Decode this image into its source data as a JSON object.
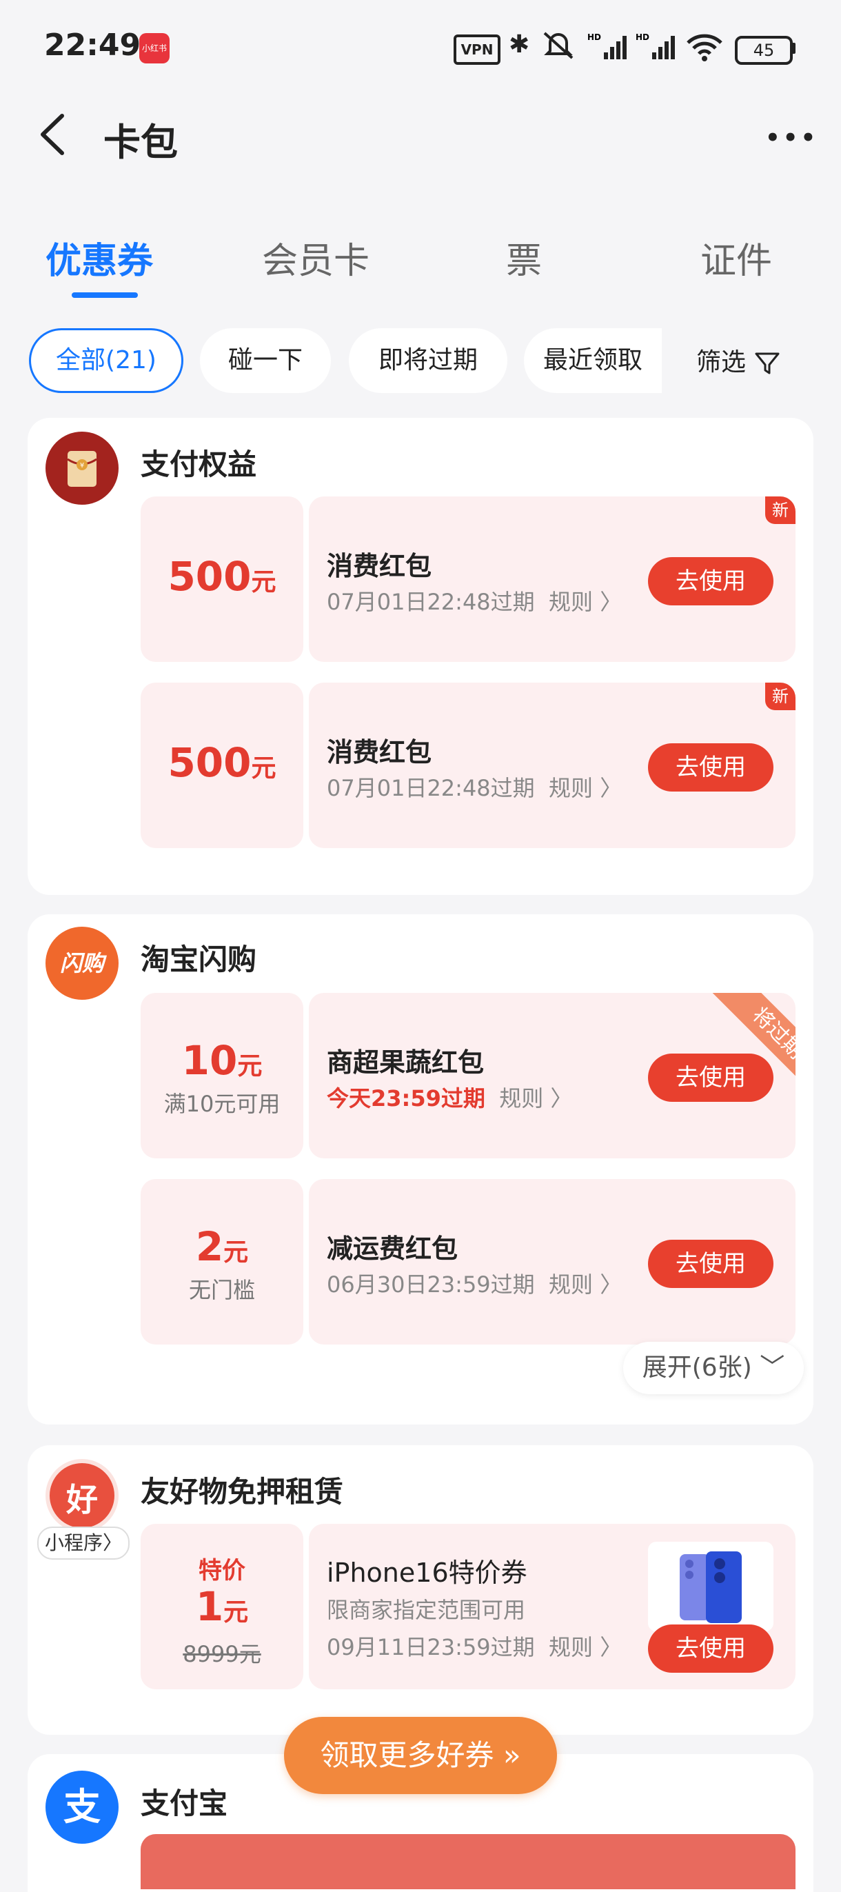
{
  "status_bar": {
    "time": "22:49",
    "app_badge": "小红书",
    "vpn": "VPN",
    "battery": "45",
    "icons": [
      "vpn-icon",
      "bluetooth-icon",
      "mute-icon",
      "signal-hd-icon",
      "signal-hd-icon",
      "wifi-icon",
      "battery-icon"
    ]
  },
  "header": {
    "title": "卡包",
    "more": "•••"
  },
  "tabs": [
    {
      "label": "优惠券",
      "active": true
    },
    {
      "label": "会员卡",
      "active": false
    },
    {
      "label": "票",
      "active": false
    },
    {
      "label": "证件",
      "active": false
    }
  ],
  "filters": [
    {
      "label": "全部(21)",
      "active": true
    },
    {
      "label": "碰一下",
      "active": false
    },
    {
      "label": "即将过期",
      "active": false
    },
    {
      "label": "最近领取",
      "active": false
    }
  ],
  "filter_button": "筛选",
  "sections": [
    {
      "title": "支付权益",
      "coupons": [
        {
          "amount": "500",
          "unit": "元",
          "name": "消费红包",
          "expiry": "07月01日22:48过期",
          "rule": "规则 〉",
          "button": "去使用",
          "tag": "新"
        },
        {
          "amount": "500",
          "unit": "元",
          "name": "消费红包",
          "expiry": "07月01日22:48过期",
          "rule": "规则 〉",
          "button": "去使用",
          "tag": "新"
        }
      ]
    },
    {
      "title": "淘宝闪购",
      "logo_text": "闪购",
      "coupons": [
        {
          "amount": "10",
          "unit": "元",
          "sub": "满10元可用",
          "name": "商超果蔬红包",
          "expiry": "今天23:59过期",
          "rule": "规则 〉",
          "button": "去使用",
          "ribbon": "将过期"
        },
        {
          "amount": "2",
          "unit": "元",
          "sub": "无门槛",
          "name": "减运费红包",
          "expiry": "06月30日23:59过期",
          "rule": "规则 〉",
          "button": "去使用"
        }
      ],
      "expand": "展开(6张) ﹀"
    },
    {
      "title": "友好物免押租赁",
      "logo_text": "好",
      "logo_label": "小程序〉",
      "coupons": [
        {
          "top": "特价",
          "amount": "1",
          "unit": "元",
          "orig": "8999元",
          "name": "iPhone16特价券",
          "desc": "限商家指定范围可用",
          "expiry": "09月11日23:59过期",
          "rule": "规则 〉",
          "button": "去使用"
        }
      ]
    },
    {
      "title": "支付宝",
      "logo_text": "支"
    }
  ],
  "get_more": "领取更多好券 »"
}
